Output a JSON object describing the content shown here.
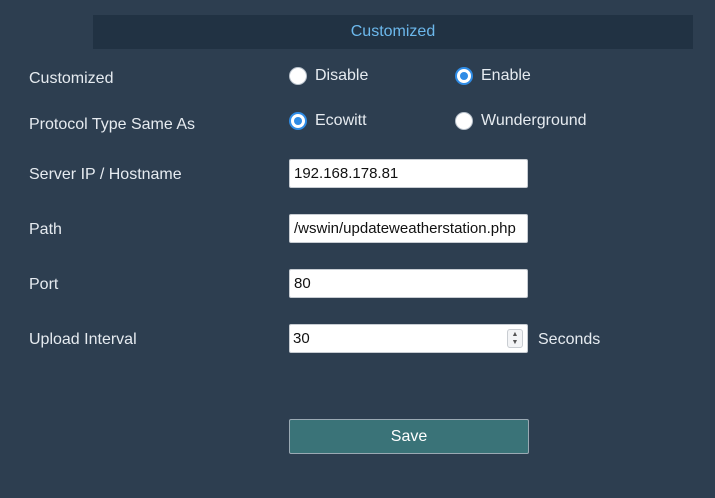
{
  "header": {
    "title": "Customized"
  },
  "customized": {
    "label": "Customized",
    "options": [
      {
        "label": "Disable",
        "checked": false
      },
      {
        "label": "Enable",
        "checked": true
      }
    ]
  },
  "protocol": {
    "label": "Protocol Type Same As",
    "options": [
      {
        "label": "Ecowitt",
        "checked": true
      },
      {
        "label": "Wunderground",
        "checked": false
      }
    ]
  },
  "server": {
    "label": "Server IP / Hostname",
    "value": "192.168.178.81"
  },
  "path": {
    "label": "Path",
    "value": "/wswin/updateweatherstation.php"
  },
  "port": {
    "label": "Port",
    "value": "80"
  },
  "interval": {
    "label": "Upload Interval",
    "value": "30",
    "unit": "Seconds"
  },
  "actions": {
    "save_label": "Save"
  },
  "colors": {
    "background": "#2d3e50",
    "header_bar": "#213243",
    "header_text": "#6cb8ec",
    "radio_accent": "#2f8ce6",
    "save_button": "#3a7378"
  },
  "icons": {
    "spinner": "number-spinner-icon"
  }
}
